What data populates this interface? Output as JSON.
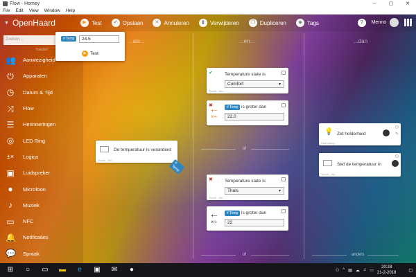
{
  "window": {
    "title": "Flow - Homey",
    "minimize": "─",
    "maximize": "▢",
    "close": "✕"
  },
  "menu": [
    "File",
    "Edit",
    "View",
    "Window",
    "Help"
  ],
  "header": {
    "home_title": "OpenHaard",
    "toolbar": {
      "test": "Test",
      "save": "Opslaan",
      "cancel": "Annuleren",
      "delete": "Verwijderen",
      "duplicate": "Dupliceren",
      "tags": "Tags"
    },
    "user": "Menno"
  },
  "sidebar": {
    "search_placeholder": "Zoeken...",
    "section_label": "Toestel",
    "items": [
      {
        "label": "Aanwezigheid",
        "icon": "people-icon"
      },
      {
        "label": "Apparaten",
        "icon": "plug-icon"
      },
      {
        "label": "Datum & Tijd",
        "icon": "clock-icon"
      },
      {
        "label": "Flow",
        "icon": "flow-icon"
      },
      {
        "label": "Herinneringen",
        "icon": "list-icon"
      },
      {
        "label": "LED Ring",
        "icon": "ring-icon"
      },
      {
        "label": "Logica",
        "icon": "math-icon"
      },
      {
        "label": "Luidspreker",
        "icon": "speaker-icon"
      },
      {
        "label": "Microfoon",
        "icon": "microphone-icon"
      },
      {
        "label": "Muziek",
        "icon": "music-icon"
      },
      {
        "label": "NFC",
        "icon": "nfc-icon"
      },
      {
        "label": "Notificaties",
        "icon": "bell-icon"
      },
      {
        "label": "Spraak",
        "icon": "speech-icon"
      }
    ]
  },
  "columns": {
    "when": "...als...",
    "and": "...en...",
    "then": "...dan"
  },
  "popup": {
    "tag": "# Temp",
    "value": "24.5",
    "test": "Test"
  },
  "trigger_card": {
    "title": "De temperatuur is veranderd",
    "footer": "Toon8 - Wo...",
    "tag": "# Temp"
  },
  "condition_cards": [
    {
      "title": "Temperature state is",
      "value": "Comfort",
      "footer": "Toon8 - Wo...",
      "mark": "✔"
    },
    {
      "title": "is groter dan",
      "tag": "# Temp",
      "value": "22.0",
      "mark": "✖"
    },
    {
      "title": "Temperature state is",
      "value": "Thuis",
      "footer": "Toon8 - Wo...",
      "mark": "✖"
    },
    {
      "title": "is groter dan",
      "tag": "# Temp",
      "value": "22"
    }
  ],
  "action_cards": [
    {
      "title": "Zet helderheid",
      "footer": "Haardlamp..."
    },
    {
      "title": "Stel de temperatuur in",
      "footer": "Toon8 - Wo..."
    }
  ],
  "or_labels": {
    "mid": "of",
    "bottom": "of",
    "then_bottom": "anders"
  },
  "taskbar": {
    "time": "20:28",
    "date": "21-2-2018"
  }
}
